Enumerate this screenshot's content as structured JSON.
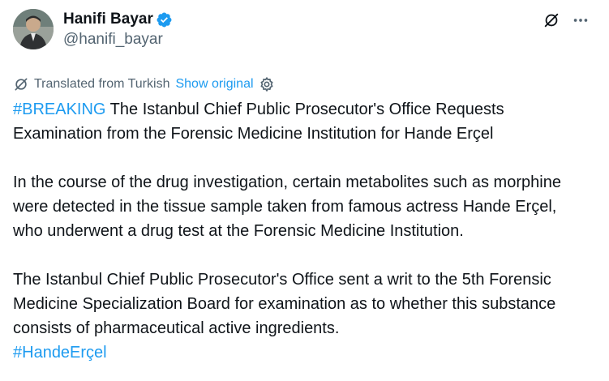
{
  "author": {
    "display_name": "Hanifi Bayar",
    "handle": "@hanifi_bayar",
    "avatar_icon": "person-avatar",
    "verified_icon": "verified-badge-icon",
    "verified_color": "#1d9bf0"
  },
  "header_actions": {
    "grok_icon": "grok-icon",
    "more_icon": "more-dots-icon"
  },
  "translation": {
    "label": "Translated from Turkish",
    "show_original": "Show original",
    "icon": "globe-slash-icon",
    "settings_icon": "gear-icon"
  },
  "post": {
    "hashtag_breaking": "#BREAKING",
    "headline": " The Istanbul Chief Public Prosecutor's Office Requests Examination from the Forensic Medicine Institution for Hande Erçel",
    "paragraph_2": "In the course of the drug investigation, certain metabolites such as morphine were detected in the tissue sample taken from famous actress Hande Erçel, who underwent a drug test at the Forensic Medicine Institution.",
    "paragraph_3": "The Istanbul Chief Public Prosecutor's Office sent a writ to the 5th Forensic Medicine Specialization Board for examination as to whether this substance consists of pharmaceutical active ingredients.",
    "hashtag_end": "#HandeErçel"
  },
  "colors": {
    "link": "#1d9bf0",
    "text": "#0f1419",
    "muted": "#536471"
  }
}
